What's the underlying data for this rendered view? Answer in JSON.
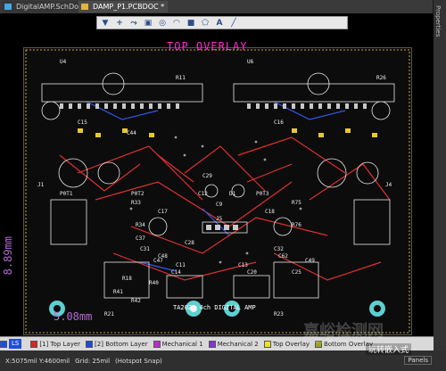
{
  "tabs": [
    {
      "label": "DigitalAMP.SchDoc",
      "active": false
    },
    {
      "label": "DAMP_P1.PCBDOC *",
      "active": true
    }
  ],
  "side_panel": {
    "label": "Properties"
  },
  "toolbar": {
    "icons": [
      "filter-icon",
      "add-icon",
      "route-icon",
      "pad-icon",
      "via-icon",
      "arc-icon",
      "fill-icon",
      "polygon-icon",
      "string-icon",
      "line-icon"
    ]
  },
  "board": {
    "overlay_title": "TOP OVERLAY",
    "bottom_text": "TA2022 4ch DIGITAL AMP",
    "dim_vertical": "8.89mm",
    "dim_horizontal": "5.08mm",
    "component_labels": [
      "U4",
      "U6",
      "R11",
      "R26",
      "C15",
      "C16",
      "C17",
      "C18",
      "C44",
      "R33",
      "R75",
      "R34",
      "R76",
      "C29",
      "C12",
      "C9",
      "J5",
      "C37",
      "D1",
      "C28",
      "C31",
      "C32",
      "R18",
      "R40",
      "R41",
      "R42",
      "C48",
      "C62",
      "R21",
      "R23",
      "C11",
      "C14",
      "C13",
      "C20",
      "C25",
      "C47",
      "C49",
      "J1",
      "J4",
      "P0T1",
      "P0T2",
      "P0T3"
    ],
    "colors": {
      "background": "#000000",
      "overlay": "#ffffff",
      "title": "#ff2ad4",
      "track_top": "#e03030",
      "pad": "#c0c0c0",
      "dimension": "#b36ad0",
      "mech": "#ffd23a"
    }
  },
  "layerbar": {
    "ls": "LS",
    "layers": [
      {
        "label": "[1] Top Layer",
        "color": "#e02222"
      },
      {
        "label": "[2] Bottom Layer",
        "color": "#1f48e0"
      },
      {
        "label": "Mechanical 1",
        "color": "#c02ad0"
      },
      {
        "label": "Mechanical 2",
        "color": "#8a2fd8"
      },
      {
        "label": "Top Overlay",
        "color": "#f0e020"
      },
      {
        "label": "Bottom Overlay",
        "color": "#a0a020"
      }
    ]
  },
  "status": {
    "coords": "X:5075mil Y:4600mil",
    "grid": "Grid: 25mil",
    "snap": "(Hotspot Snap)",
    "panels": "Panels"
  },
  "watermark": {
    "text": "嘉峪检测网",
    "url": "AnyTesting.com",
    "logo": "玩转嵌入式"
  }
}
